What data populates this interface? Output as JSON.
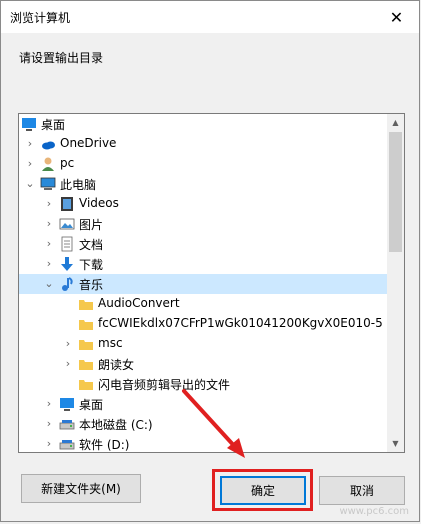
{
  "dialog": {
    "title": "浏览计算机",
    "close_glyph": "✕",
    "prompt": "请设置输出目录"
  },
  "tree": [
    {
      "label": "桌面",
      "icon": "desktop-icon",
      "expander": "",
      "indent": 0
    },
    {
      "label": "OneDrive",
      "icon": "onedrive-cloud-icon",
      "expander": "›",
      "indent": 1
    },
    {
      "label": "pc",
      "icon": "user-icon",
      "expander": "›",
      "indent": 1
    },
    {
      "label": "此电脑",
      "icon": "computer-icon",
      "expander": "⌄",
      "indent": 1
    },
    {
      "label": "Videos",
      "icon": "video-folder-icon",
      "expander": "›",
      "indent": 2
    },
    {
      "label": "图片",
      "icon": "pictures-folder-icon",
      "expander": "›",
      "indent": 2
    },
    {
      "label": "文档",
      "icon": "documents-folder-icon",
      "expander": "›",
      "indent": 2
    },
    {
      "label": "下载",
      "icon": "downloads-folder-icon",
      "expander": "›",
      "indent": 2
    },
    {
      "label": "音乐",
      "icon": "music-folder-icon",
      "expander": "⌄",
      "indent": 2,
      "selected": true
    },
    {
      "label": "AudioConvert",
      "icon": "folder-icon",
      "expander": "",
      "indent": 3
    },
    {
      "label": "fcCWIEkdlx07CFrP1wGk01041200KgvX0E010-5",
      "icon": "folder-icon",
      "expander": "",
      "indent": 3
    },
    {
      "label": "msc",
      "icon": "folder-icon",
      "expander": "›",
      "indent": 3
    },
    {
      "label": "朗读女",
      "icon": "folder-icon",
      "expander": "›",
      "indent": 3
    },
    {
      "label": "闪电音频剪辑导出的文件",
      "icon": "folder-icon",
      "expander": "",
      "indent": 3
    },
    {
      "label": "桌面",
      "icon": "desktop-icon",
      "expander": "›",
      "indent": 2
    },
    {
      "label": "本地磁盘 (C:)",
      "icon": "drive-icon",
      "expander": "›",
      "indent": 2
    },
    {
      "label": "软件 (D:)",
      "icon": "drive-icon",
      "expander": "›",
      "indent": 2
    }
  ],
  "buttons": {
    "new_folder": "新建文件夹(M)",
    "ok": "确定",
    "cancel": "取消"
  },
  "watermark": "www.pc6.com",
  "colors": {
    "selection": "#cce8ff",
    "folder": "#f5c84c",
    "accent": "#0078d7",
    "annotation": "#e02020"
  }
}
